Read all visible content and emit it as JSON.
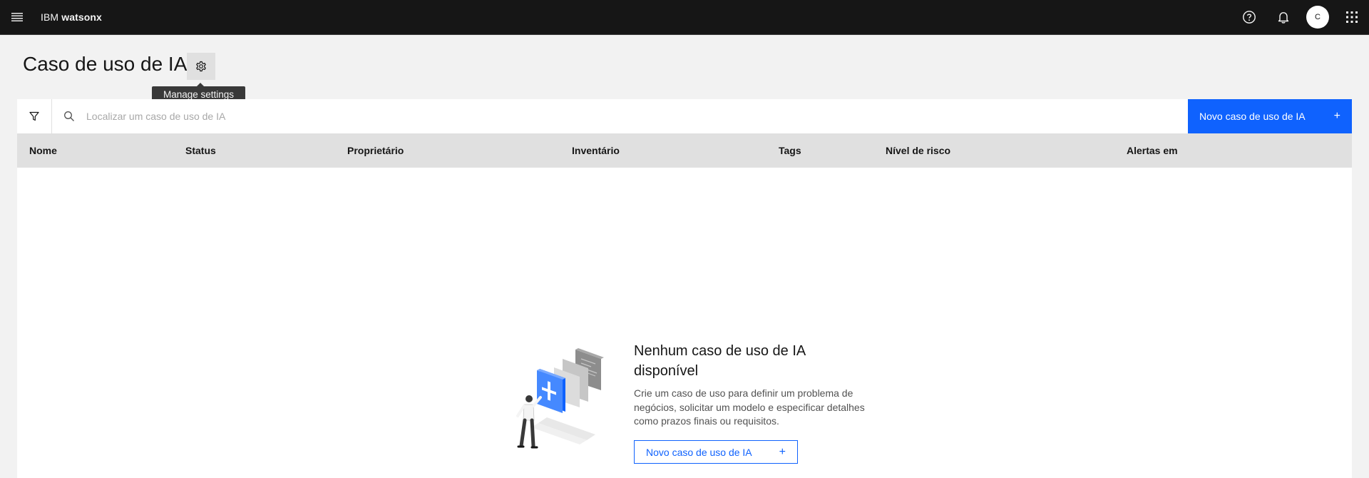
{
  "header": {
    "brand_prefix": "IBM",
    "brand_product": "watsonx",
    "avatar_initial": "C",
    "icons": [
      "menu-icon",
      "help-icon",
      "notification-icon",
      "app-switcher-icon"
    ]
  },
  "page": {
    "title": "Caso de uso de IA",
    "settings_tooltip": "Manage settings"
  },
  "toolbar": {
    "search_placeholder": "Localizar um caso de uso de IA",
    "search_value": "",
    "new_button_label": "Novo caso de uso de IA",
    "new_button_icon": "+"
  },
  "table": {
    "columns": [
      "Nome",
      "Status",
      "Proprietário",
      "Inventário",
      "Tags",
      "Nível de risco",
      "Alertas em"
    ],
    "rows": []
  },
  "empty_state": {
    "title": "Nenhum caso de uso de IA disponível",
    "description": "Crie um caso de uso para definir um problema de negócios, solicitar um modelo e especificar detalhes como prazos finais ou requisitos.",
    "button_label": "Novo caso de uso de IA",
    "button_icon": "+"
  },
  "colors": {
    "header_bg": "#161616",
    "primary": "#0f62fe",
    "page_bg": "#f2f2f2",
    "table_header_bg": "#e0e0e0"
  }
}
